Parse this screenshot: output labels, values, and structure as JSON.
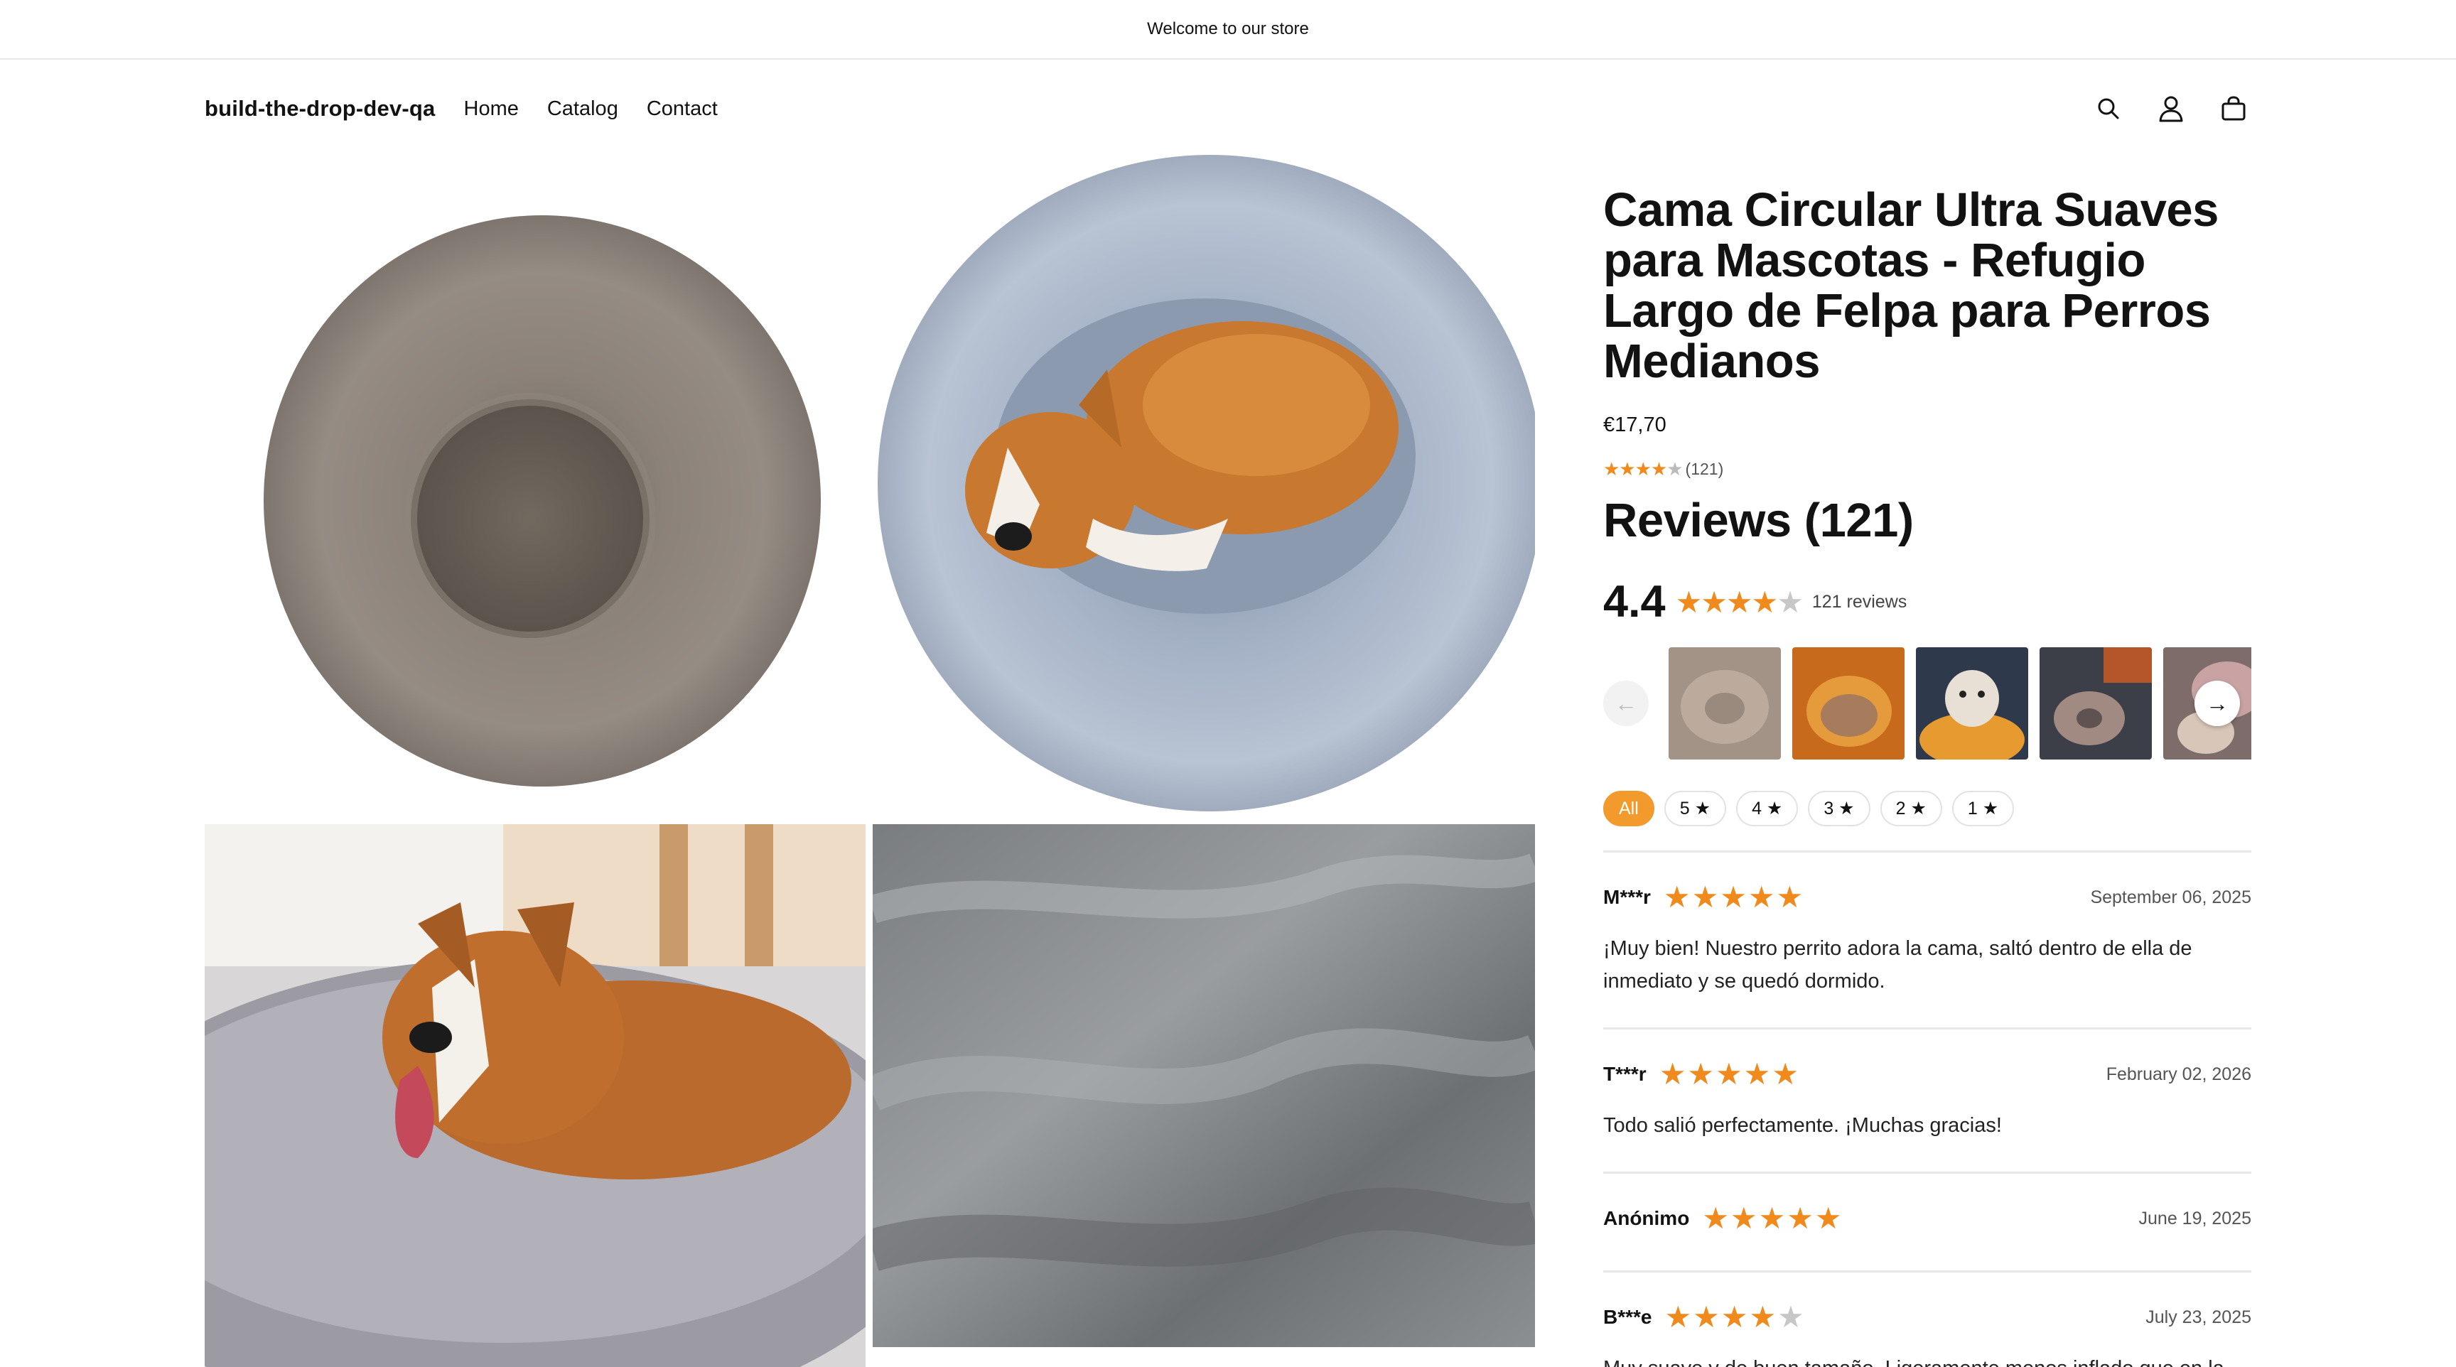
{
  "announcement": "Welcome to our store",
  "header": {
    "brand": "build-the-drop-dev-qa",
    "nav": [
      "Home",
      "Catalog",
      "Contact"
    ]
  },
  "product": {
    "title": "Cama Circular Ultra Suaves para Mascotas - Refugio Largo de Felpa para Perros Medianos",
    "price": "€17,70",
    "rating_count": "(121)",
    "rating_value": 4
  },
  "reviews": {
    "heading": "Reviews (121)",
    "average": "4.4",
    "average_stars": 4,
    "count_label": "121 reviews",
    "filters": [
      "All",
      "5 ★",
      "4 ★",
      "3 ★",
      "2 ★",
      "1 ★"
    ],
    "items": [
      {
        "author": "M***r",
        "stars": 5,
        "date": "September 06, 2025",
        "body": "¡Muy bien! Nuestro perrito adora la cama, saltó dentro de ella de inmediato y se quedó dormido."
      },
      {
        "author": "T***r",
        "stars": 5,
        "date": "February 02, 2026",
        "body": "Todo salió perfectamente. ¡Muchas gracias!"
      },
      {
        "author": "Anónimo",
        "stars": 5,
        "date": "June 19, 2025",
        "body": ""
      },
      {
        "author": "B***e",
        "stars": 4,
        "date": "July 23, 2025",
        "body": "Muy suave y de buen tamaño. Ligeramente menos inflado que en la"
      }
    ]
  },
  "colors": {
    "accent": "#f08a1c",
    "chip_active": "#f39a2c",
    "text": "#121212"
  },
  "icons": [
    "search-icon",
    "account-icon",
    "cart-icon",
    "arrow-left-icon",
    "arrow-right-icon",
    "star-icon"
  ]
}
